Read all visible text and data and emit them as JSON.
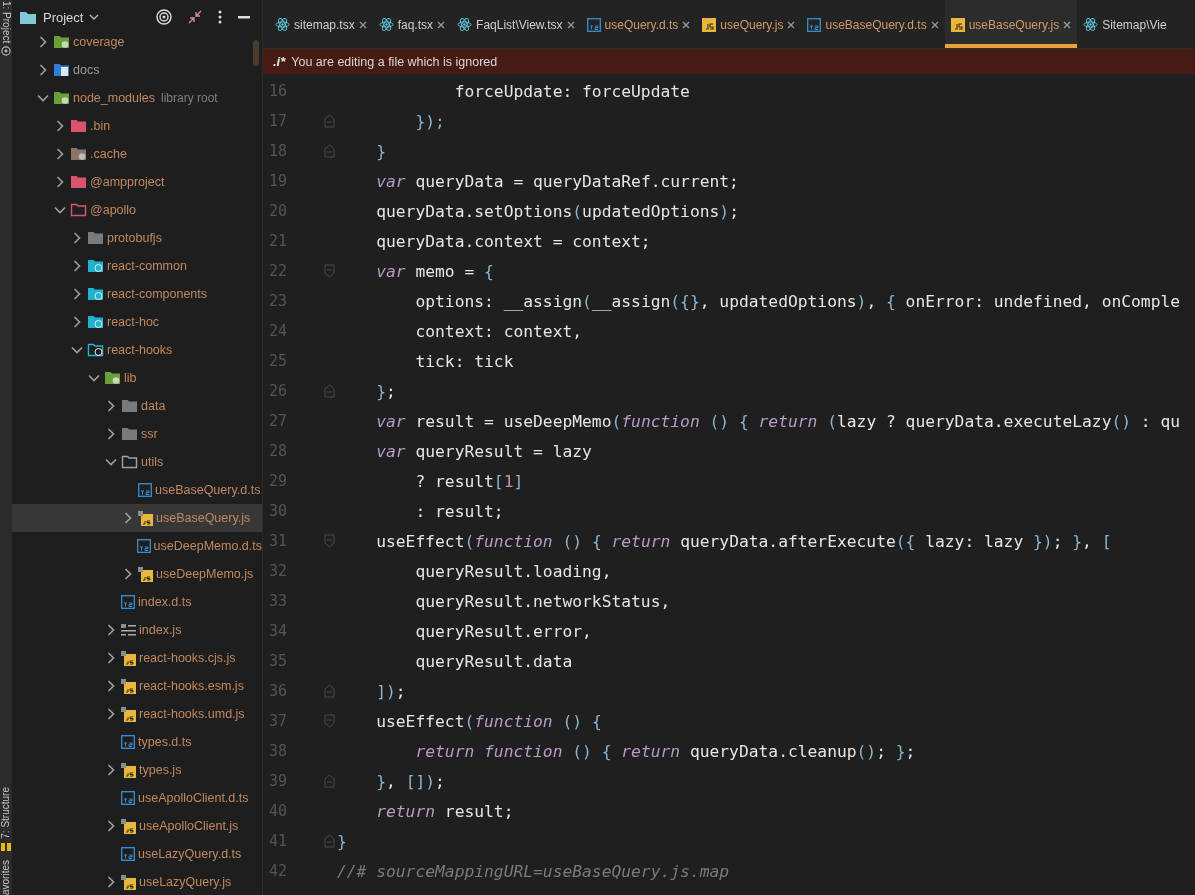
{
  "tool_strip": [
    {
      "label": "1: Project",
      "kind": "project"
    },
    {
      "label": "7: Structure",
      "kind": "structure"
    },
    {
      "label": "avorites",
      "kind": "favorites"
    }
  ],
  "project_panel": {
    "title": "Project"
  },
  "tree": [
    {
      "name": "coverage",
      "kind": "test-folder",
      "ignored": true,
      "expandable": true,
      "expanded": false,
      "selected": false
    },
    {
      "name": "docs",
      "kind": "docs-folder",
      "ignored": false,
      "expandable": true,
      "expanded": false,
      "selected": false
    },
    {
      "name": "node_modules",
      "note": "library root",
      "kind": "lib-folder",
      "ignored": true,
      "expandable": true,
      "expanded": true,
      "selected": false,
      "children": [
        {
          "name": ".bin",
          "kind": "red-folder",
          "ignored": true,
          "expandable": true,
          "expanded": false,
          "selected": false
        },
        {
          "name": ".cache",
          "kind": "cache-folder",
          "ignored": true,
          "expandable": true,
          "expanded": false,
          "selected": false
        },
        {
          "name": "@ampproject",
          "kind": "red-folder",
          "ignored": true,
          "expandable": true,
          "expanded": false,
          "selected": false
        },
        {
          "name": "@apollo",
          "kind": "red-folder-open",
          "ignored": true,
          "expandable": true,
          "expanded": true,
          "selected": false,
          "children": [
            {
              "name": "protobufjs",
              "kind": "grey-folder",
              "ignored": true,
              "expandable": true,
              "expanded": false,
              "selected": false
            },
            {
              "name": "react-common",
              "kind": "react-folder",
              "ignored": true,
              "expandable": true,
              "expanded": false,
              "selected": false
            },
            {
              "name": "react-components",
              "kind": "react-folder",
              "ignored": true,
              "expandable": true,
              "expanded": false,
              "selected": false
            },
            {
              "name": "react-hoc",
              "kind": "react-folder",
              "ignored": true,
              "expandable": true,
              "expanded": false,
              "selected": false
            },
            {
              "name": "react-hooks",
              "kind": "react-folder-open",
              "ignored": true,
              "expandable": true,
              "expanded": true,
              "selected": false,
              "children": [
                {
                  "name": "lib",
                  "kind": "lib-folder",
                  "ignored": true,
                  "expandable": true,
                  "expanded": true,
                  "selected": false,
                  "children": [
                    {
                      "name": "data",
                      "kind": "grey-folder",
                      "ignored": true,
                      "expandable": true,
                      "expanded": false,
                      "selected": false
                    },
                    {
                      "name": "ssr",
                      "kind": "grey-folder",
                      "ignored": true,
                      "expandable": true,
                      "expanded": false,
                      "selected": false
                    },
                    {
                      "name": "utils",
                      "kind": "outline-folder",
                      "ignored": true,
                      "expandable": true,
                      "expanded": true,
                      "selected": false,
                      "children": [
                        {
                          "name": "useBaseQuery.d.ts",
                          "kind": "ts",
                          "ignored": true,
                          "expandable": false,
                          "selected": false
                        },
                        {
                          "name": "useBaseQuery.js",
                          "kind": "js",
                          "ignored": true,
                          "expandable": true,
                          "expanded": false,
                          "selected": true
                        },
                        {
                          "name": "useDeepMemo.d.ts",
                          "kind": "ts",
                          "ignored": true,
                          "expandable": false,
                          "selected": false
                        },
                        {
                          "name": "useDeepMemo.js",
                          "kind": "js",
                          "ignored": true,
                          "expandable": true,
                          "expanded": false,
                          "selected": false
                        }
                      ]
                    },
                    {
                      "name": "index.d.ts",
                      "kind": "ts",
                      "ignored": true,
                      "expandable": false,
                      "selected": false
                    },
                    {
                      "name": "index.js",
                      "kind": "index",
                      "ignored": true,
                      "expandable": true,
                      "expanded": false,
                      "selected": false
                    },
                    {
                      "name": "react-hooks.cjs.js",
                      "kind": "js",
                      "ignored": true,
                      "expandable": true,
                      "expanded": false,
                      "selected": false
                    },
                    {
                      "name": "react-hooks.esm.js",
                      "kind": "js",
                      "ignored": true,
                      "expandable": true,
                      "expanded": false,
                      "selected": false
                    },
                    {
                      "name": "react-hooks.umd.js",
                      "kind": "js",
                      "ignored": true,
                      "expandable": true,
                      "expanded": false,
                      "selected": false
                    },
                    {
                      "name": "types.d.ts",
                      "kind": "ts",
                      "ignored": true,
                      "expandable": false,
                      "selected": false
                    },
                    {
                      "name": "types.js",
                      "kind": "js",
                      "ignored": true,
                      "expandable": true,
                      "expanded": false,
                      "selected": false
                    },
                    {
                      "name": "useApolloClient.d.ts",
                      "kind": "ts",
                      "ignored": true,
                      "expandable": false,
                      "selected": false
                    },
                    {
                      "name": "useApolloClient.js",
                      "kind": "js",
                      "ignored": true,
                      "expandable": true,
                      "expanded": false,
                      "selected": false
                    },
                    {
                      "name": "useLazyQuery.d.ts",
                      "kind": "ts",
                      "ignored": true,
                      "expandable": false,
                      "selected": false
                    },
                    {
                      "name": "useLazyQuery.js",
                      "kind": "js",
                      "ignored": true,
                      "expandable": true,
                      "expanded": false,
                      "selected": false
                    }
                  ]
                }
              ]
            }
          ]
        }
      ]
    }
  ],
  "tabs": [
    {
      "label": "sitemap.tsx",
      "kind": "react",
      "ignored": false,
      "selected": false,
      "closable": true
    },
    {
      "label": "faq.tsx",
      "kind": "react",
      "ignored": false,
      "selected": false,
      "closable": true
    },
    {
      "label": "FaqList\\View.tsx",
      "kind": "react",
      "ignored": false,
      "selected": false,
      "closable": true
    },
    {
      "label": "useQuery.d.ts",
      "kind": "ts",
      "ignored": true,
      "selected": false,
      "closable": true
    },
    {
      "label": "useQuery.js",
      "kind": "js",
      "ignored": true,
      "selected": false,
      "closable": true
    },
    {
      "label": "useBaseQuery.d.ts",
      "kind": "ts",
      "ignored": true,
      "selected": false,
      "closable": true
    },
    {
      "label": "useBaseQuery.js",
      "kind": "js",
      "ignored": true,
      "selected": true,
      "closable": true
    },
    {
      "label": "Sitemap\\Vie",
      "kind": "react",
      "ignored": false,
      "selected": false,
      "closable": false
    }
  ],
  "banner": {
    "badge": ".i*",
    "message": "You are editing a file which is ignored"
  },
  "code_lines": [
    {
      "number": "16",
      "kind": "plain",
      "tokens": [
        {
          "kind": "plain",
          "text": "            forceUpdate: forceUpdate"
        }
      ]
    },
    {
      "number": "17",
      "kind": "fold-end",
      "tokens": [
        {
          "kind": "punct",
          "text": "        });"
        }
      ]
    },
    {
      "number": "18",
      "kind": "fold-end",
      "tokens": [
        {
          "kind": "punct",
          "text": "    }"
        }
      ]
    },
    {
      "number": "19",
      "kind": "plain",
      "tokens": [
        {
          "kind": "keyword",
          "text": "    var"
        },
        {
          "kind": "plain",
          "text": " queryData = queryDataRef.current;"
        }
      ]
    },
    {
      "number": "20",
      "kind": "plain",
      "tokens": [
        {
          "kind": "plain",
          "text": "    queryData.setOptions"
        },
        {
          "kind": "punct",
          "text": "("
        },
        {
          "kind": "plain",
          "text": "updatedOptions"
        },
        {
          "kind": "punct",
          "text": ")"
        },
        {
          "kind": "plain",
          "text": ";"
        }
      ]
    },
    {
      "number": "21",
      "kind": "plain",
      "tokens": [
        {
          "kind": "plain",
          "text": "    queryData.context = context;"
        }
      ]
    },
    {
      "number": "22",
      "kind": "fold-start",
      "tokens": [
        {
          "kind": "keyword",
          "text": "    var"
        },
        {
          "kind": "plain",
          "text": " memo = "
        },
        {
          "kind": "punct",
          "text": "{"
        }
      ]
    },
    {
      "number": "23",
      "kind": "plain",
      "tokens": [
        {
          "kind": "plain",
          "text": "        options: __assign"
        },
        {
          "kind": "punct",
          "text": "("
        },
        {
          "kind": "plain",
          "text": "__assign"
        },
        {
          "kind": "punct",
          "text": "({}"
        },
        {
          "kind": "plain",
          "text": ", updatedOptions"
        },
        {
          "kind": "punct",
          "text": ")"
        },
        {
          "kind": "plain",
          "text": ", "
        },
        {
          "kind": "punct",
          "text": "{"
        },
        {
          "kind": "plain",
          "text": " onError: undefined, onComple"
        }
      ]
    },
    {
      "number": "24",
      "kind": "plain",
      "tokens": [
        {
          "kind": "plain",
          "text": "        context: context,"
        }
      ]
    },
    {
      "number": "25",
      "kind": "plain",
      "tokens": [
        {
          "kind": "plain",
          "text": "        tick: tick"
        }
      ]
    },
    {
      "number": "26",
      "kind": "fold-end",
      "tokens": [
        {
          "kind": "punct",
          "text": "    }"
        },
        {
          "kind": "plain",
          "text": ";"
        }
      ]
    },
    {
      "number": "27",
      "kind": "plain",
      "tokens": [
        {
          "kind": "keyword",
          "text": "    var"
        },
        {
          "kind": "plain",
          "text": " result = useDeepMemo"
        },
        {
          "kind": "punct",
          "text": "("
        },
        {
          "kind": "keyword",
          "text": "function"
        },
        {
          "kind": "punct",
          "text": " () { "
        },
        {
          "kind": "keyword",
          "text": "return"
        },
        {
          "kind": "punct",
          "text": " ("
        },
        {
          "kind": "plain",
          "text": "lazy ? queryData.executeLazy"
        },
        {
          "kind": "punct",
          "text": "()"
        },
        {
          "kind": "plain",
          "text": " : qu"
        }
      ]
    },
    {
      "number": "28",
      "kind": "plain",
      "tokens": [
        {
          "kind": "keyword",
          "text": "    var"
        },
        {
          "kind": "plain",
          "text": " queryResult = lazy"
        }
      ]
    },
    {
      "number": "29",
      "kind": "plain",
      "tokens": [
        {
          "kind": "plain",
          "text": "        ? result"
        },
        {
          "kind": "punct",
          "text": "["
        },
        {
          "kind": "number",
          "text": "1"
        },
        {
          "kind": "punct",
          "text": "]"
        }
      ]
    },
    {
      "number": "30",
      "kind": "plain",
      "tokens": [
        {
          "kind": "plain",
          "text": "        : result;"
        }
      ]
    },
    {
      "number": "31",
      "kind": "fold-start",
      "tokens": [
        {
          "kind": "plain",
          "text": "    useEffect"
        },
        {
          "kind": "punct",
          "text": "("
        },
        {
          "kind": "keyword",
          "text": "function"
        },
        {
          "kind": "punct",
          "text": " () { "
        },
        {
          "kind": "keyword",
          "text": "return"
        },
        {
          "kind": "plain",
          "text": " queryData.afterExecute"
        },
        {
          "kind": "punct",
          "text": "({"
        },
        {
          "kind": "plain",
          "text": " lazy: lazy "
        },
        {
          "kind": "punct",
          "text": "})"
        },
        {
          "kind": "plain",
          "text": "; "
        },
        {
          "kind": "punct",
          "text": "}"
        },
        {
          "kind": "plain",
          "text": ", "
        },
        {
          "kind": "punct",
          "text": "["
        }
      ]
    },
    {
      "number": "32",
      "kind": "plain",
      "tokens": [
        {
          "kind": "plain",
          "text": "        queryResult.loading,"
        }
      ]
    },
    {
      "number": "33",
      "kind": "plain",
      "tokens": [
        {
          "kind": "plain",
          "text": "        queryResult.networkStatus,"
        }
      ]
    },
    {
      "number": "34",
      "kind": "plain",
      "tokens": [
        {
          "kind": "plain",
          "text": "        queryResult.error,"
        }
      ]
    },
    {
      "number": "35",
      "kind": "plain",
      "tokens": [
        {
          "kind": "plain",
          "text": "        queryResult.data"
        }
      ]
    },
    {
      "number": "36",
      "kind": "fold-end",
      "tokens": [
        {
          "kind": "punct",
          "text": "    ])"
        },
        {
          "kind": "plain",
          "text": ";"
        }
      ]
    },
    {
      "number": "37",
      "kind": "fold-start",
      "tokens": [
        {
          "kind": "plain",
          "text": "    useEffect"
        },
        {
          "kind": "punct",
          "text": "("
        },
        {
          "kind": "keyword",
          "text": "function"
        },
        {
          "kind": "punct",
          "text": " () {"
        }
      ]
    },
    {
      "number": "38",
      "kind": "plain",
      "tokens": [
        {
          "kind": "keyword",
          "text": "        return function"
        },
        {
          "kind": "punct",
          "text": " () { "
        },
        {
          "kind": "keyword",
          "text": "return"
        },
        {
          "kind": "plain",
          "text": " queryData.cleanup"
        },
        {
          "kind": "punct",
          "text": "()"
        },
        {
          "kind": "plain",
          "text": "; "
        },
        {
          "kind": "punct",
          "text": "}"
        },
        {
          "kind": "plain",
          "text": ";"
        }
      ]
    },
    {
      "number": "39",
      "kind": "fold-end",
      "tokens": [
        {
          "kind": "punct",
          "text": "    }"
        },
        {
          "kind": "plain",
          "text": ", "
        },
        {
          "kind": "punct",
          "text": "[])"
        },
        {
          "kind": "plain",
          "text": ";"
        }
      ]
    },
    {
      "number": "40",
      "kind": "plain",
      "tokens": [
        {
          "kind": "keyword",
          "text": "    return"
        },
        {
          "kind": "plain",
          "text": " result;"
        }
      ]
    },
    {
      "number": "41",
      "kind": "fold-end",
      "tokens": [
        {
          "kind": "punct",
          "text": "}"
        }
      ]
    },
    {
      "number": "42",
      "kind": "plain",
      "tokens": [
        {
          "kind": "comment",
          "text": "//# sourceMappingURL=useBaseQuery.js.map"
        }
      ]
    }
  ]
}
